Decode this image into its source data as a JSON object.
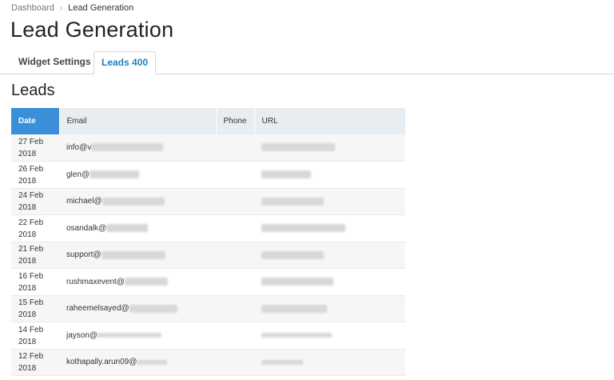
{
  "breadcrumb": {
    "parent": "Dashboard",
    "current": "Lead Generation"
  },
  "page_title": "Lead Generation",
  "tabs": [
    {
      "label": "Widget Settings",
      "active": false
    },
    {
      "label": "Leads 400",
      "active": true
    }
  ],
  "section_title": "Leads",
  "table": {
    "headers": {
      "date": "Date",
      "email": "Email",
      "phone": "Phone",
      "url": "URL"
    },
    "rows": [
      {
        "date_day": "27 Feb",
        "date_year": "2018",
        "email": "info@v"
      },
      {
        "date_day": "26 Feb",
        "date_year": "2018",
        "email": "glen@"
      },
      {
        "date_day": "24 Feb",
        "date_year": "2018",
        "email": "michael@"
      },
      {
        "date_day": "22 Feb",
        "date_year": "2018",
        "email": "osandalk@"
      },
      {
        "date_day": "21 Feb",
        "date_year": "2018",
        "email": "support@"
      },
      {
        "date_day": "16 Feb",
        "date_year": "2018",
        "email": "rushmaxevent@"
      },
      {
        "date_day": "15 Feb",
        "date_year": "2018",
        "email": "raheemelsayed@"
      },
      {
        "date_day": "14 Feb",
        "date_year": "2018",
        "email": "jayson@"
      },
      {
        "date_day": "12 Feb",
        "date_year": "2018",
        "email": "kothapally.arun09@"
      }
    ]
  },
  "colors": {
    "accent": "#3a8fd8",
    "tab_active_text": "#1f7fc2",
    "header_bg": "#e8edf1"
  }
}
